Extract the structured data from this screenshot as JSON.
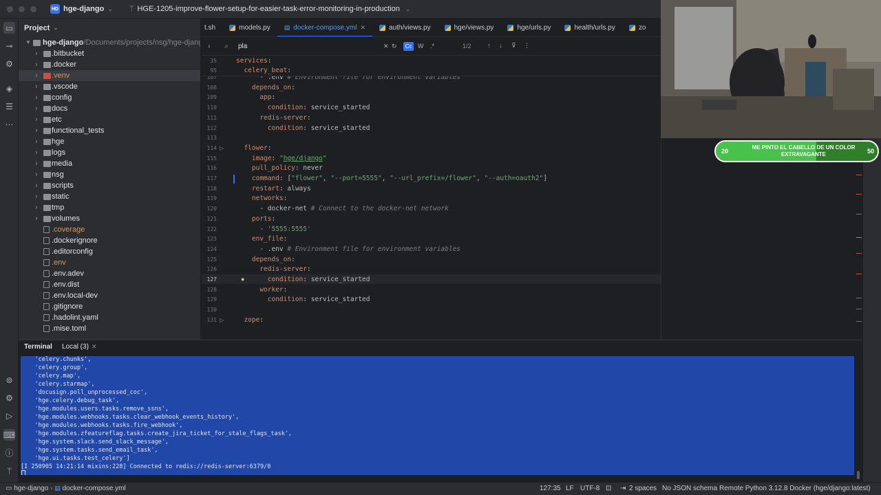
{
  "titlebar": {
    "project_badge": "HD",
    "project_name": "hge-django",
    "branch": "HGE-1205-improve-flower-setup-for-easier-task-error-monitoring-in-production"
  },
  "project_panel": {
    "title": "Project",
    "root_name": "hge-django",
    "root_path": "~/Documents/projects/nsg/hge-django",
    "items": [
      {
        "name": ".bitbucket",
        "type": "folder"
      },
      {
        "name": ".docker",
        "type": "folder"
      },
      {
        "name": ".venv",
        "type": "folder-excluded"
      },
      {
        "name": ".vscode",
        "type": "folder"
      },
      {
        "name": "config",
        "type": "folder"
      },
      {
        "name": "docs",
        "type": "folder"
      },
      {
        "name": "etc",
        "type": "folder"
      },
      {
        "name": "functional_tests",
        "type": "folder"
      },
      {
        "name": "hge",
        "type": "folder"
      },
      {
        "name": "logs",
        "type": "folder"
      },
      {
        "name": "media",
        "type": "folder"
      },
      {
        "name": "nsg",
        "type": "folder"
      },
      {
        "name": "scripts",
        "type": "folder"
      },
      {
        "name": "static",
        "type": "folder"
      },
      {
        "name": "tmp",
        "type": "folder"
      },
      {
        "name": "volumes",
        "type": "folder"
      },
      {
        "name": ".coverage",
        "type": "file-ignored"
      },
      {
        "name": ".dockerignore",
        "type": "file"
      },
      {
        "name": ".editorconfig",
        "type": "file"
      },
      {
        "name": ".env",
        "type": "file-ignored"
      },
      {
        "name": ".env.adev",
        "type": "file"
      },
      {
        "name": ".env.dist",
        "type": "file"
      },
      {
        "name": ".env.local-dev",
        "type": "file"
      },
      {
        "name": ".gitignore",
        "type": "file"
      },
      {
        "name": ".hadolint.yaml",
        "type": "file"
      },
      {
        "name": ".mise.toml",
        "type": "file"
      }
    ]
  },
  "tabs": [
    {
      "label": "t.sh",
      "icon": "shell-icon"
    },
    {
      "label": "models.py",
      "icon": "python-icon"
    },
    {
      "label": "docker-compose.yml",
      "icon": "yaml-icon",
      "active": true
    },
    {
      "label": "auth/views.py",
      "icon": "python-icon"
    },
    {
      "label": "hge/views.py",
      "icon": "python-icon"
    },
    {
      "label": "hge/urls.py",
      "icon": "python-icon"
    },
    {
      "label": "health/urls.py",
      "icon": "python-icon"
    },
    {
      "label": "zo",
      "icon": "python-icon"
    }
  ],
  "find": {
    "query": "pla",
    "match_case": "Cc",
    "words": "W",
    "regex": ".*",
    "count": "1/2"
  },
  "sticky_lines": [
    {
      "num": "35",
      "text": "services:"
    },
    {
      "num": "95",
      "text": "  celery_beat:"
    }
  ],
  "code_lines": [
    {
      "num": "107",
      "text": "      - .env # Environment file for environment variables"
    },
    {
      "num": "108",
      "text": "    depends_on:"
    },
    {
      "num": "109",
      "text": "      app:"
    },
    {
      "num": "110",
      "text": "        condition: service_started"
    },
    {
      "num": "111",
      "text": "      redis-server:"
    },
    {
      "num": "112",
      "text": "        condition: service_started"
    },
    {
      "num": "113",
      "text": ""
    },
    {
      "num": "114",
      "text": "  flower:"
    },
    {
      "num": "115",
      "text": "    image: \"hge/django\""
    },
    {
      "num": "116",
      "text": "    pull_policy: never"
    },
    {
      "num": "117",
      "text": "    command: [\"flower\", \"--port=5555\", \"--url_prefix=/flower\", \"--auth=oauth2\"]"
    },
    {
      "num": "118",
      "text": "    restart: always"
    },
    {
      "num": "119",
      "text": "    networks:"
    },
    {
      "num": "120",
      "text": "      - docker-net # Connect to the docker-net network"
    },
    {
      "num": "121",
      "text": "    ports:"
    },
    {
      "num": "122",
      "text": "      - '5555:5555'"
    },
    {
      "num": "123",
      "text": "    env_file:"
    },
    {
      "num": "124",
      "text": "      - .env # Environment file for environment variables"
    },
    {
      "num": "125",
      "text": "    depends_on:"
    },
    {
      "num": "126",
      "text": "      redis-server:"
    },
    {
      "num": "127",
      "text": "        condition: service_started"
    },
    {
      "num": "128",
      "text": "      worker:"
    },
    {
      "num": "129",
      "text": "        condition: service_started"
    },
    {
      "num": "130",
      "text": ""
    },
    {
      "num": "131",
      "text": "  zope:"
    }
  ],
  "overlay": {
    "left_value": "20",
    "right_value": "50",
    "text": "ME PINTO EL CABELLO DE UN COLOR EXTRAVAGANTE",
    "progress": 0.62
  },
  "terminal": {
    "tab_main": "Terminal",
    "tab_local": "Local (3)",
    "lines": [
      "    'celery.chunks',",
      "    'celery.group',",
      "    'celery.map',",
      "    'celery.starmap',",
      "    'docusign.poll_unprocessed_coc',",
      "    'hge.celery.debug_task',",
      "    'hge.modules.users.tasks.remove_ssns',",
      "    'hge.modules.webhooks.tasks.clear_webhook_events_history',",
      "    'hge.modules.webhooks.tasks.fire_webhook',",
      "    'hge.modules.zfeatureflag.tasks.create_jira_ticket_for_stale_flags_task',",
      "    'hge.system.slack.send_slack_message',",
      "    'hge.system.tasks.send_email_task',",
      "    'hge.ui.tasks.test_celery']",
      "[I 250905 14:21:14 mixins:228] Connected to redis://redis-server:6379/0"
    ]
  },
  "statusbar": {
    "project": "hge-django",
    "file": "docker-compose.yml",
    "position": "127:35",
    "line_sep": "LF",
    "encoding": "UTF-8",
    "indent": "2 spaces",
    "schema": "No JSON schema",
    "interpreter": "Remote Python 3.12.8 Docker (hge/django:latest)"
  }
}
